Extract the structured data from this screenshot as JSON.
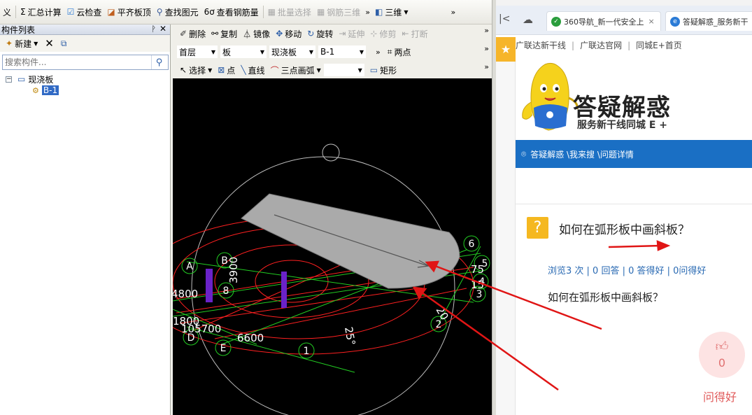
{
  "main_toolbar": {
    "items": [
      {
        "label": "义",
        "icon": "char-icon"
      },
      {
        "label": "汇总计算",
        "icon": "sigma-icon",
        "glyph": "Σ"
      },
      {
        "label": "云检查",
        "icon": "cloud-check-icon",
        "glyph": "☑"
      },
      {
        "label": "平齐板顶",
        "icon": "align-slab-icon",
        "glyph": "◪"
      },
      {
        "label": "查找图元",
        "icon": "find-element-icon",
        "glyph": "⚲"
      },
      {
        "label": "查看钢筋量",
        "icon": "rebar-view-icon",
        "glyph": "6ơ"
      },
      {
        "label": "批量选择",
        "icon": "batch-select-icon",
        "glyph": "▦",
        "disabled": true
      },
      {
        "label": "钢筋三维",
        "icon": "rebar-3d-icon",
        "glyph": "▦",
        "disabled": true
      }
    ],
    "view_mode": "三维"
  },
  "panel": {
    "title": "构件列表",
    "new_label": "新建",
    "search_placeholder": "搜索构件...",
    "tree": {
      "root": "现浇板",
      "child": "B-1"
    }
  },
  "cad_toolbar": {
    "row1": [
      "删除",
      "复制",
      "镜像",
      "移动",
      "旋转",
      "延伸",
      "修剪",
      "打断"
    ],
    "row2": {
      "floor": "首层",
      "type": "板",
      "subtype": "现浇板",
      "name": "B-1",
      "mode": "两点"
    },
    "row3": {
      "select": "选择",
      "point": "点",
      "line": "直线",
      "arc": "三点画弧",
      "rect": "矩形"
    }
  },
  "canvas": {
    "axis_labels": [
      "A",
      "B",
      "D",
      "E",
      "8",
      "1",
      "2",
      "6",
      "5",
      "4",
      "3"
    ],
    "dims": [
      "3900",
      "4800",
      "1800",
      "105700",
      "6600",
      "25°",
      "20",
      "75",
      "15"
    ]
  },
  "browser": {
    "tabs": [
      {
        "label": "360导航_新一代安全上",
        "close": "×"
      },
      {
        "label": "答疑解惑_服务新干"
      }
    ],
    "bookmarks": [
      "广联达新干线",
      "广联达官网",
      "同城E+首页"
    ],
    "site_title": "答疑解惑",
    "site_subtitle": "服务新干线同城 E +",
    "breadcrumb": "答疑解惑 \\我来搜 \\问题详情",
    "question_title": "如何在弧形板中画斜板？",
    "stats": "浏览3 次 | 0 回答 | 0 答得好 | 0问得好",
    "question_body": "如何在弧形板中画斜板？",
    "like_count": "0",
    "like_label": "问得好"
  },
  "colors": {
    "canvas_bg": "#000000",
    "slab": "#aaaaaa",
    "arc_lines": "#ff2020",
    "axis_green": "#22cc22",
    "member_purple": "#6a22c8",
    "annotation_arrow": "#e01515",
    "site_blue": "#1a6fc4",
    "badge_yellow": "#f5b820"
  }
}
